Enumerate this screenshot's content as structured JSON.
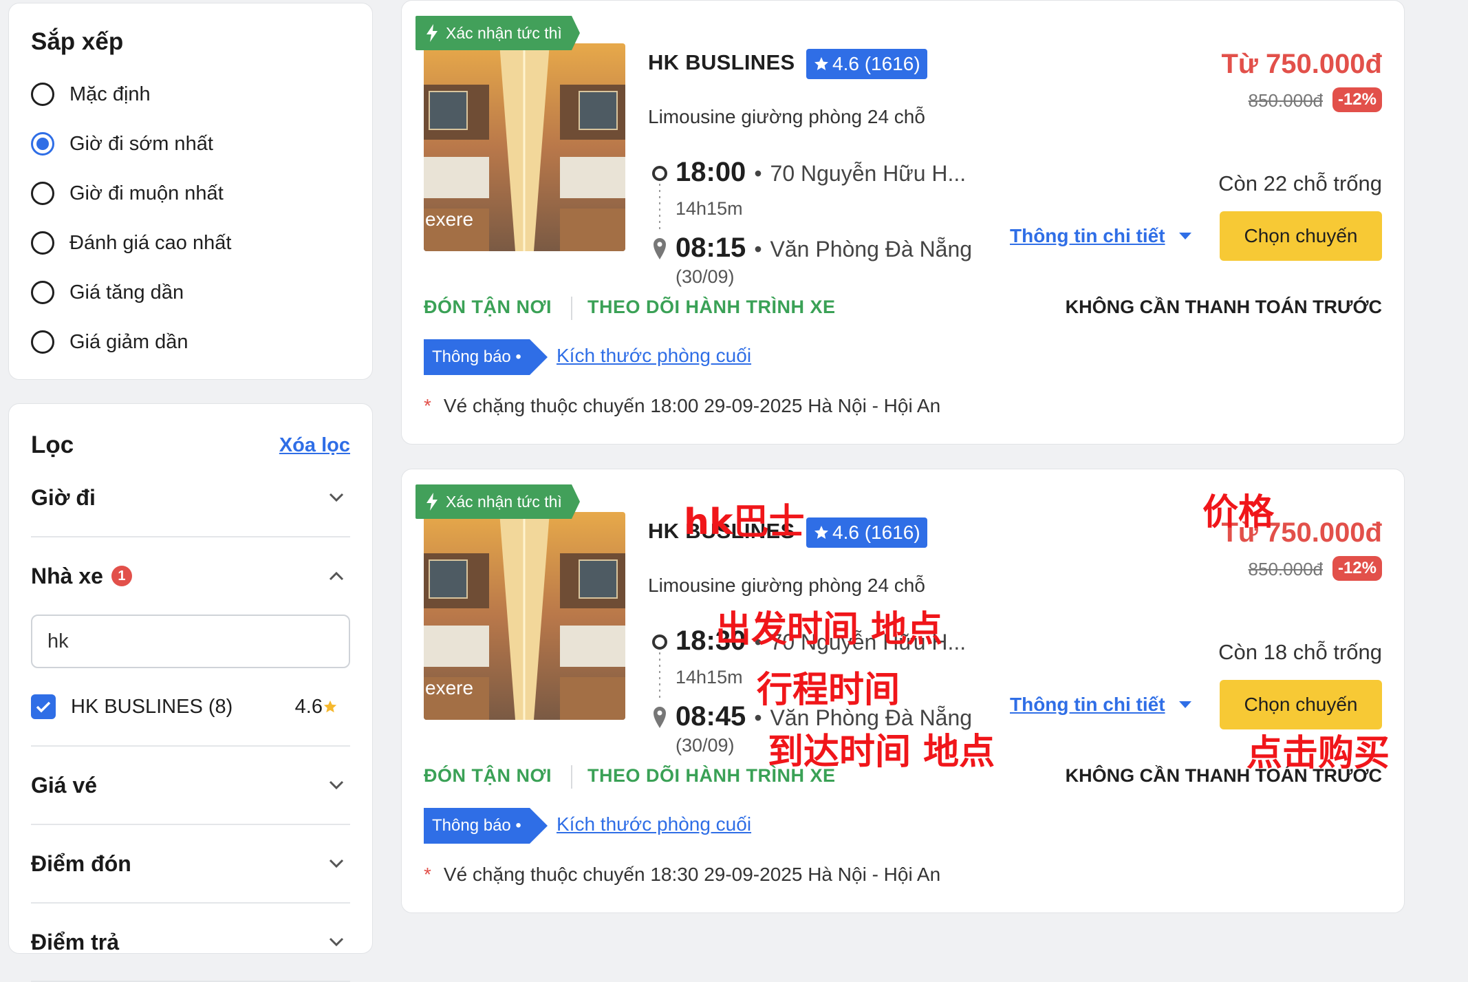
{
  "sort": {
    "title": "Sắp xếp",
    "options": [
      "Mặc định",
      "Giờ đi sớm nhất",
      "Giờ đi muộn nhất",
      "Đánh giá cao nhất",
      "Giá tăng dần",
      "Giá giảm dần"
    ],
    "selected_index": 1
  },
  "filter": {
    "title": "Lọc",
    "clear_label": "Xóa lọc",
    "sections": {
      "depart_time": "Giờ đi",
      "operator": "Nhà xe",
      "operator_badge": "1",
      "price": "Giá vé",
      "pickup": "Điểm đón",
      "dropoff": "Điểm trả"
    },
    "operator_search_value": "hk",
    "operator_option": {
      "label": "HK BUSLINES (8)",
      "rating": "4.6",
      "checked": true
    }
  },
  "trips": [
    {
      "instant_tag": "Xác nhận tức thì",
      "photo_watermark": "exere",
      "operator": "HK BUSLINES",
      "rating": "4.6 (1616)",
      "bus_type": "Limousine giường phòng 24 chỗ",
      "depart_time": "18:00",
      "depart_place": "70 Nguyễn Hữu H...",
      "duration": "14h15m",
      "arrive_time": "08:15",
      "arrive_place": "Văn Phòng Đà Nẵng",
      "arrive_date": "(30/09)",
      "price": "Từ 750.000đ",
      "old_price": "850.000đ",
      "discount": "-12%",
      "seats": "Còn 22 chỗ trống",
      "detail_label": "Thông tin chi tiết",
      "book_label": "Chọn chuyến",
      "feature_1": "ĐÓN TẬN NƠI",
      "feature_2": "THEO DÕI HÀNH TRÌNH XE",
      "no_prepay": "KHÔNG CẦN THANH TOÁN TRƯỚC",
      "notice_tag": "Thông báo •",
      "notice_link": "Kích thước phòng cuối",
      "ticket_note": "Vé chặng thuộc chuyến 18:00 29-09-2025 Hà Nội - Hội An"
    },
    {
      "instant_tag": "Xác nhận tức thì",
      "photo_watermark": "exere",
      "operator": "HK BUSLINES",
      "rating": "4.6 (1616)",
      "bus_type": "Limousine giường phòng 24 chỗ",
      "depart_time": "18:30",
      "depart_place": "70 Nguyễn Hữu H...",
      "duration": "14h15m",
      "arrive_time": "08:45",
      "arrive_place": "Văn Phòng Đà Nẵng",
      "arrive_date": "(30/09)",
      "price": "Từ 750.000đ",
      "old_price": "850.000đ",
      "discount": "-12%",
      "seats": "Còn 18 chỗ trống",
      "detail_label": "Thông tin chi tiết",
      "book_label": "Chọn chuyến",
      "feature_1": "ĐÓN TẬN NƠI",
      "feature_2": "THEO DÕI HÀNH TRÌNH XE",
      "no_prepay": "KHÔNG CẦN THANH TOÁN TRƯỚC",
      "notice_tag": "Thông báo •",
      "notice_link": "Kích thước phòng cuối",
      "ticket_note": "Vé chặng thuộc chuyến 18:30 29-09-2025 Hà Nội - Hội An"
    }
  ],
  "annotations": {
    "operator": "hk巴士",
    "price": "价格",
    "depart": "出发时间 地点",
    "duration": "行程时间",
    "arrive": "到达时间 地点",
    "buy": "点击购买"
  },
  "colors": {
    "primary": "#2f6ee6",
    "price_red": "#e2504a",
    "green": "#3aa156",
    "book_yellow": "#f7c935",
    "annotation_red": "#f0161a"
  }
}
